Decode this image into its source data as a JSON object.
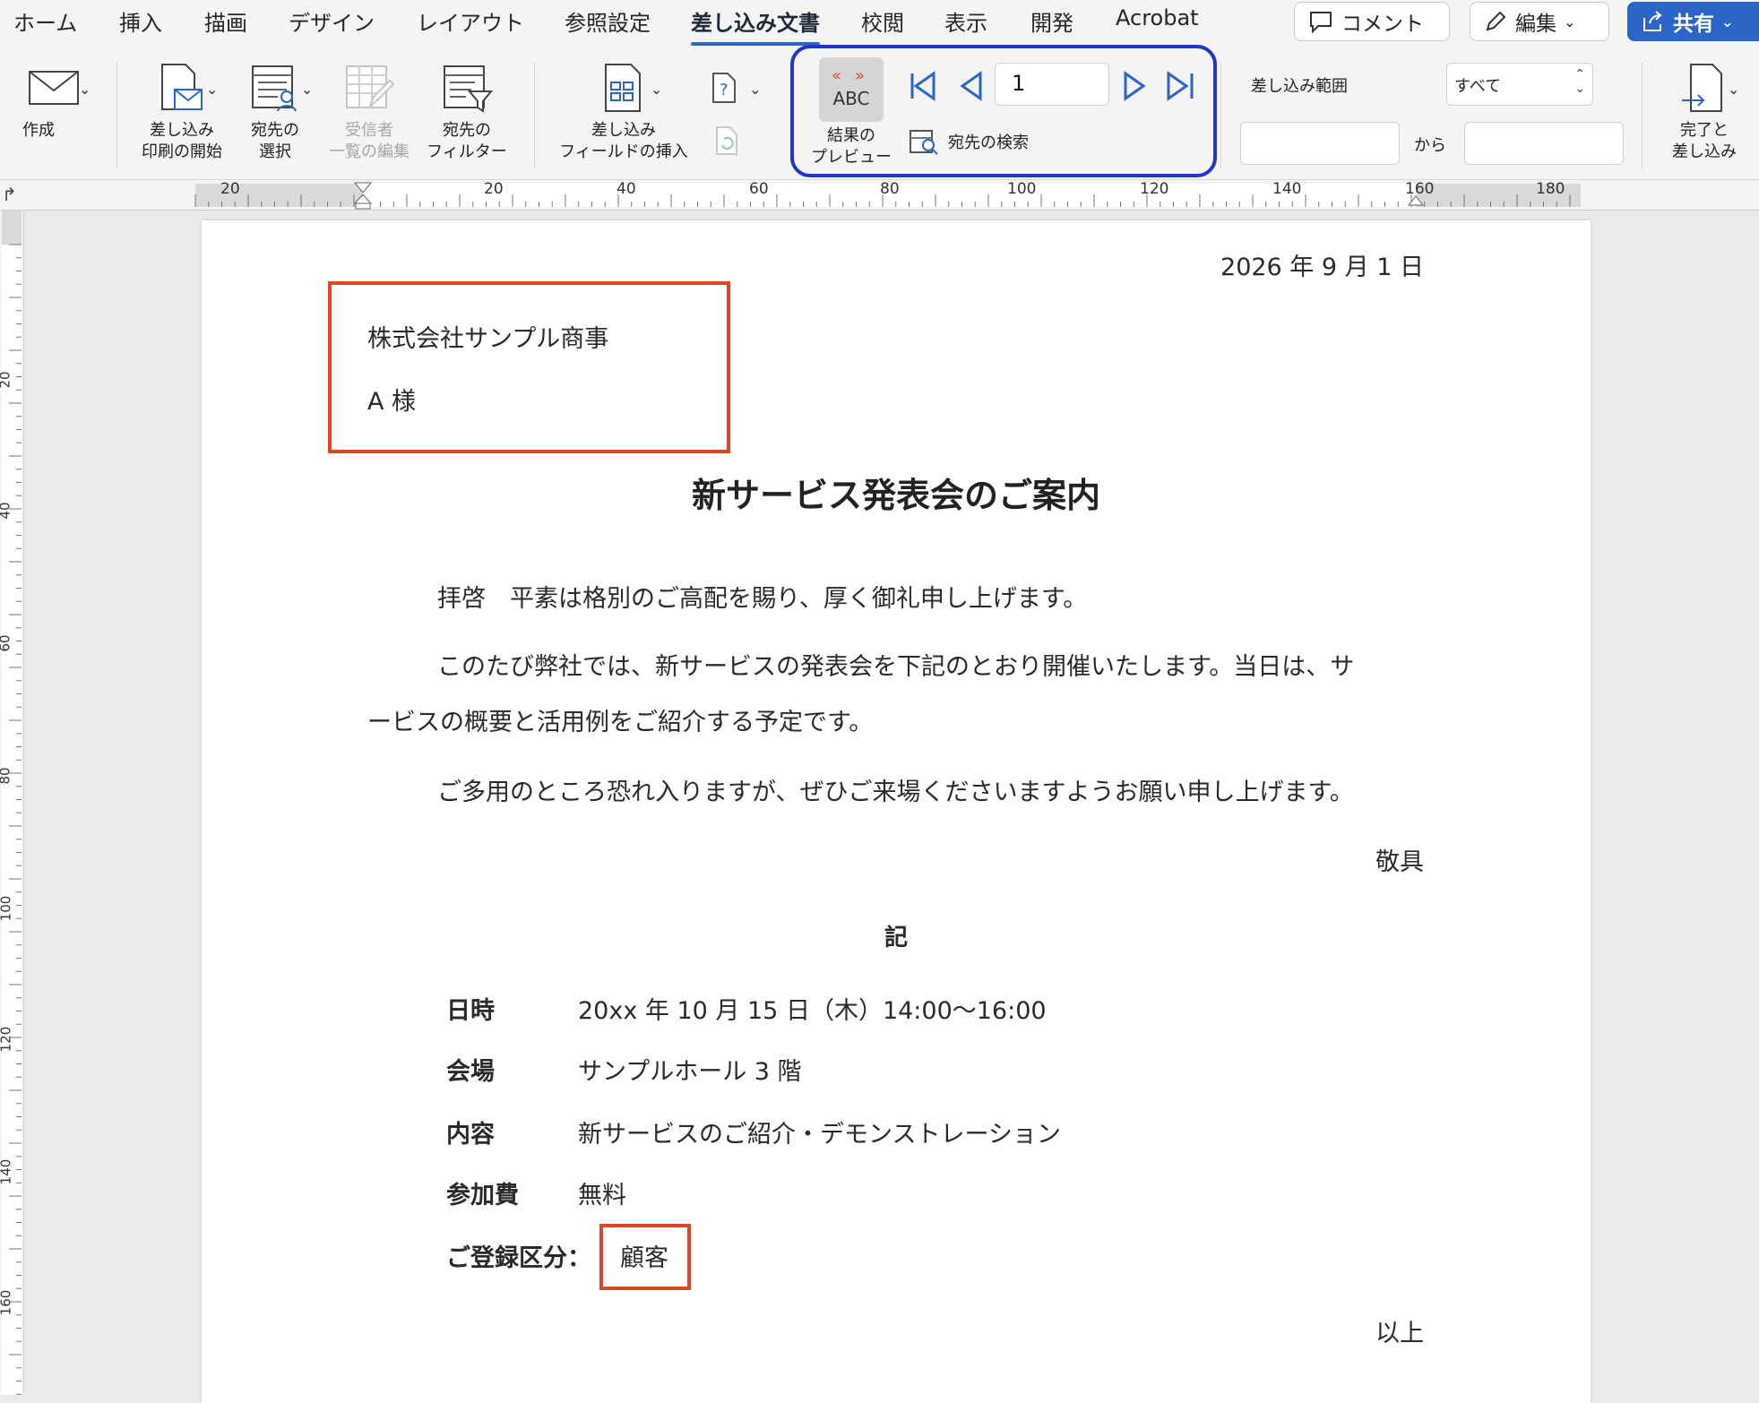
{
  "tabs": [
    "ホーム",
    "挿入",
    "描画",
    "デザイン",
    "レイアウト",
    "参照設定",
    "差し込み文書",
    "校閲",
    "表示",
    "開発",
    "Acrobat"
  ],
  "active_tab": "差し込み文書",
  "top_buttons": {
    "comment": "コメント",
    "edit": "編集",
    "share": "共有"
  },
  "ribbon": {
    "create": "作成",
    "start_merge": [
      "差し込み",
      "印刷の開始"
    ],
    "select_recipients": [
      "宛先の",
      "選択"
    ],
    "edit_recipients": [
      "受信者",
      "一覧の編集"
    ],
    "filter_recipients": [
      "宛先の",
      "フィルター"
    ],
    "insert_merge_field": [
      "差し込み",
      "フィールドの挿入"
    ],
    "preview_icon_text": "ABC",
    "preview_results": [
      "結果の",
      "プレビュー"
    ],
    "record_number": "1",
    "find_recipient": "宛先の検索",
    "merge_range_label": "差し込み範囲",
    "merge_range_value": "すべて",
    "from_label": "から",
    "finish_merge": [
      "完了と",
      "差し込み"
    ]
  },
  "ruler": {
    "h_labels": [
      "20",
      "20",
      "40",
      "60",
      "80",
      "100",
      "120",
      "140",
      "160",
      "180"
    ],
    "v_labels": [
      "20",
      "40",
      "60",
      "80",
      "100",
      "120",
      "140",
      "160"
    ]
  },
  "document": {
    "date": "2026 年 9 月 1 日",
    "company": "株式会社サンプル商事",
    "recipient": "A 様",
    "title": "新サービス発表会のご案内",
    "para1": "拝啓　平素は格別のご高配を賜り、厚く御礼申し上げます。",
    "para2_line1": "このたび弊社では、新サービスの発表会を下記のとおり開催いたします。当日は、サ",
    "para2_line2": "ービスの概要と活用例をご紹介する予定です。",
    "para3": "ご多用のところ恐れ入りますが、ぜひご来場くださいますようお願い申し上げます。",
    "closing": "敬具",
    "ki": "記",
    "details": [
      {
        "label": "日時",
        "value": "20xx 年 10 月 15 日（木）14:00〜16:00"
      },
      {
        "label": "会場",
        "value": "サンプルホール 3 階"
      },
      {
        "label": "内容",
        "value": "新サービスのご紹介・デモンストレーション"
      },
      {
        "label": "参加費",
        "value": "無料"
      }
    ],
    "registration_label": "ご登録区分：",
    "registration_value": "顧客",
    "end": "以上"
  },
  "colors": {
    "accent": "#2b65c8",
    "highlight_red": "#e2461f",
    "highlight_blue": "#1f36c7"
  }
}
